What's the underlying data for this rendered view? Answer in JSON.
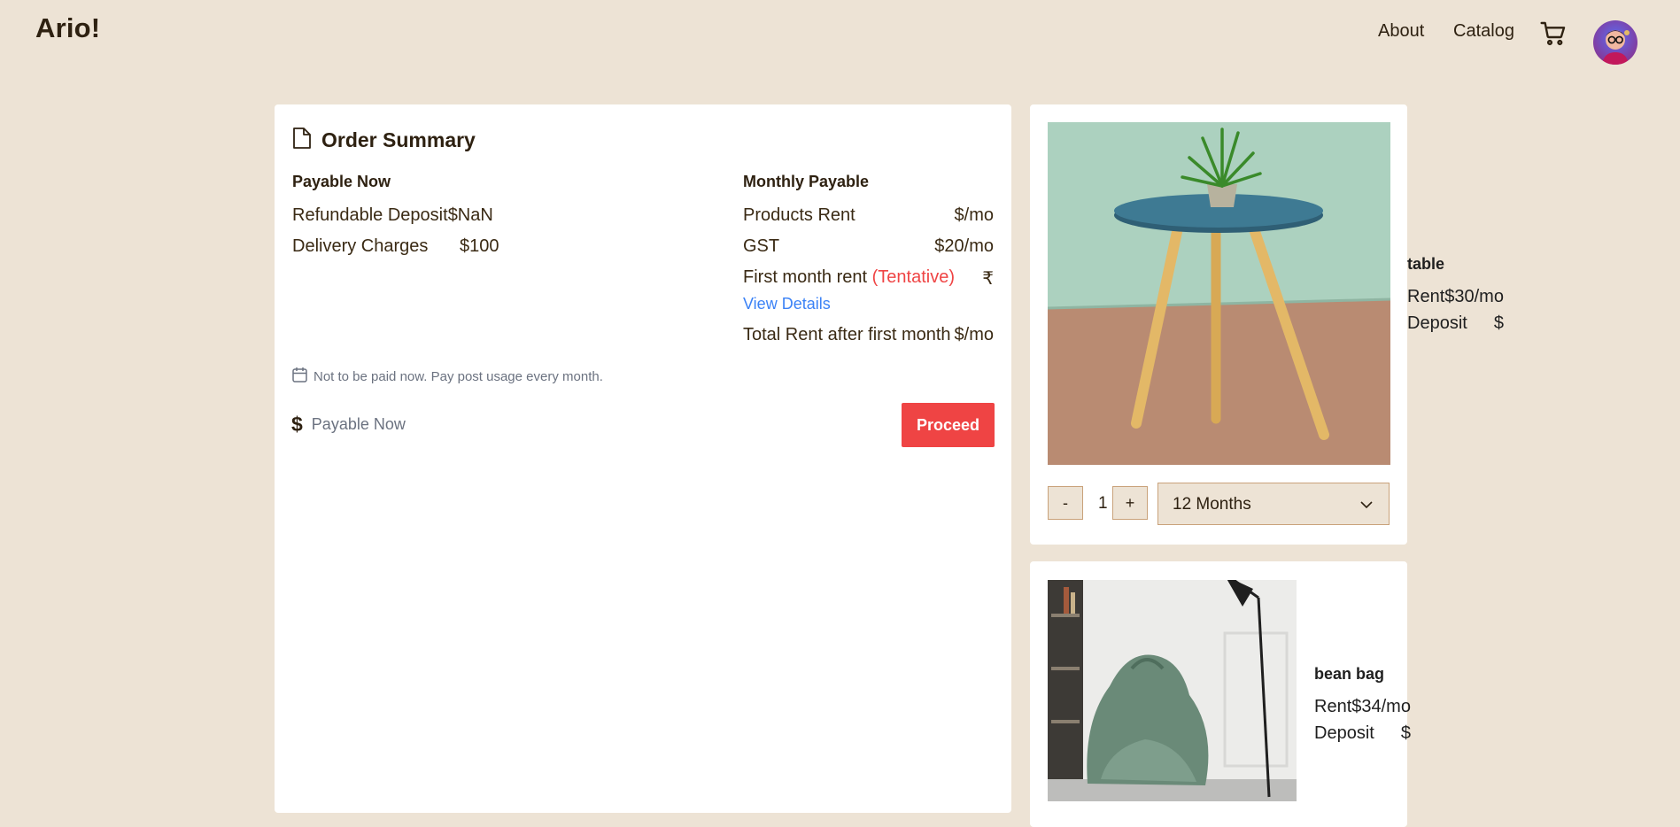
{
  "header": {
    "logo": "Ario!",
    "nav": [
      {
        "label": "About"
      },
      {
        "label": "Catalog"
      }
    ],
    "cart_icon": "cart-icon",
    "avatar_icon": "user-avatar"
  },
  "summary": {
    "title": "Order Summary",
    "title_icon": "document-icon",
    "payable_now": {
      "heading": "Payable Now",
      "refundable_deposit": {
        "label": "Refundable Deposit",
        "value": "$NaN"
      },
      "delivery_charges": {
        "label": "Delivery Charges",
        "value": "$100"
      }
    },
    "monthly": {
      "heading": "Monthly Payable",
      "products_rent": {
        "label": "Products Rent",
        "value": "$/mo"
      },
      "gst": {
        "label": "GST",
        "value": "$20/mo"
      },
      "first_month": {
        "label": "First month rent ",
        "tag": "(Tentative)",
        "value": "₹"
      },
      "view_details": "View Details",
      "total_after": {
        "label": "Total Rent after first month",
        "value": "$/mo"
      }
    },
    "note": "Not to be paid now. Pay post usage every month.",
    "note_icon": "calendar-icon",
    "pay_now": {
      "symbol": "$",
      "placeholder": "Payable Now"
    },
    "proceed": "Proceed"
  },
  "cart": [
    {
      "name": "table",
      "rent_label": "Rent",
      "rent_value": "$30/mo",
      "deposit_label": "Deposit",
      "deposit_value": "$",
      "quantity": "1",
      "minus": "-",
      "plus": "+",
      "duration": "12 Months"
    },
    {
      "name": "bean bag",
      "rent_label": "Rent",
      "rent_value": "$34/mo",
      "deposit_label": "Deposit",
      "deposit_value": "$"
    }
  ],
  "colors": {
    "background": "#ede3d5",
    "accent": "#ef4444",
    "link": "#3b82f6",
    "text": "#2e2111"
  }
}
